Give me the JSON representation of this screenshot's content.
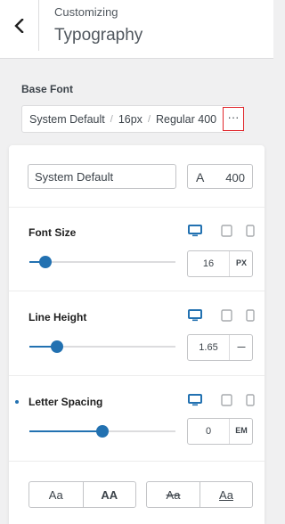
{
  "header": {
    "crumb": "Customizing",
    "title": "Typography"
  },
  "base_font": {
    "label": "Base Font",
    "family": "System Default",
    "size": "16px",
    "weight": "Regular 400",
    "more_glyph": "···"
  },
  "font_controls": {
    "family_value": "System Default",
    "weight_icon_glyph": "A",
    "weight_value": "400"
  },
  "sections": {
    "font_size": {
      "label": "Font Size",
      "value": "16",
      "unit": "PX",
      "slider_fraction": 0.11
    },
    "line_height": {
      "label": "Line Height",
      "value": "1.65",
      "unit": "—",
      "slider_fraction": 0.19
    },
    "letter_spacing": {
      "label": "Letter Spacing",
      "value": "0",
      "unit": "EM",
      "slider_fraction": 0.5
    }
  },
  "text_style_buttons": {
    "case": [
      "Aa",
      "AA"
    ],
    "decoration": [
      "Aa",
      "Aa"
    ]
  },
  "colors": {
    "accent": "#2271b1",
    "highlight_border": "#e0262b"
  },
  "icons": [
    "back-arrow-icon",
    "desktop-icon",
    "tablet-icon",
    "mobile-icon"
  ]
}
